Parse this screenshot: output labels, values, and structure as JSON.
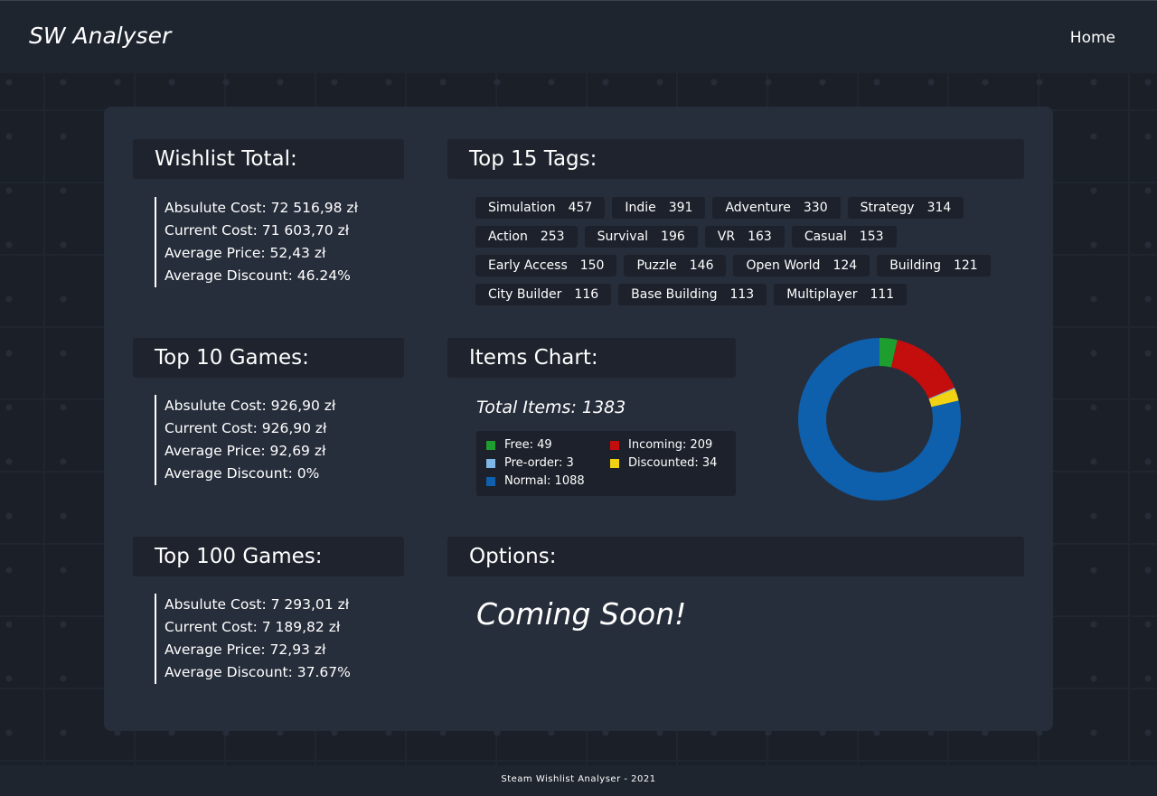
{
  "header": {
    "brand": "SW Analyser",
    "nav_home": "Home"
  },
  "wishlist_total": {
    "title": "Wishlist Total:",
    "absolute_cost": "Absulute Cost: 72 516,98 zł",
    "current_cost": "Current Cost: 71 603,70 zł",
    "average_price": "Average Price: 52,43 zł",
    "average_discount": "Average Discount: 46.24%"
  },
  "top10": {
    "title": "Top 10 Games:",
    "absolute_cost": "Absulute Cost: 926,90 zł",
    "current_cost": "Current Cost: 926,90 zł",
    "average_price": "Average Price: 92,69 zł",
    "average_discount": "Average Discount: 0%"
  },
  "top100": {
    "title": "Top 100 Games:",
    "absolute_cost": "Absulute Cost: 7 293,01 zł",
    "current_cost": "Current Cost: 7 189,82 zł",
    "average_price": "Average Price: 72,93 zł",
    "average_discount": "Average Discount: 37.67%"
  },
  "tags": {
    "title": "Top 15 Tags:",
    "rows": [
      [
        {
          "name": "Simulation",
          "count": "457"
        },
        {
          "name": "Indie",
          "count": "391"
        },
        {
          "name": "Adventure",
          "count": "330"
        },
        {
          "name": "Strategy",
          "count": "314"
        }
      ],
      [
        {
          "name": "Action",
          "count": "253"
        },
        {
          "name": "Survival",
          "count": "196"
        },
        {
          "name": "VR",
          "count": "163"
        },
        {
          "name": "Casual",
          "count": "153"
        }
      ],
      [
        {
          "name": "Early Access",
          "count": "150"
        },
        {
          "name": "Puzzle",
          "count": "146"
        },
        {
          "name": "Open World",
          "count": "124"
        },
        {
          "name": "Building",
          "count": "121"
        }
      ],
      [
        {
          "name": "City Builder",
          "count": "116"
        },
        {
          "name": "Base Building",
          "count": "113"
        },
        {
          "name": "Multiplayer",
          "count": "111"
        }
      ]
    ]
  },
  "items_chart": {
    "title": "Items Chart:",
    "total_label": "Total Items: 1383",
    "legend": [
      {
        "label": "Free: 49",
        "color": "#1e9e2e"
      },
      {
        "label": "Incoming: 209",
        "color": "#c40d0d"
      },
      {
        "label": "Pre-order: 3",
        "color": "#7fb6e6"
      },
      {
        "label": "Discounted: 34",
        "color": "#f2d313"
      },
      {
        "label": "Normal: 1088",
        "color": "#0e5fac"
      }
    ]
  },
  "chart_data": {
    "type": "pie",
    "categories": [
      "Free",
      "Incoming",
      "Pre-order",
      "Discounted",
      "Normal"
    ],
    "values": [
      49,
      209,
      3,
      34,
      1088
    ],
    "colors": [
      "#1e9e2e",
      "#c40d0d",
      "#7fb6e6",
      "#f2d313",
      "#0e5fac"
    ],
    "title": "Items Chart:"
  },
  "options": {
    "title": "Options:",
    "coming_soon": "Coming Soon!"
  },
  "footer": {
    "text": "Steam Wishlist Analyser - 2021"
  }
}
